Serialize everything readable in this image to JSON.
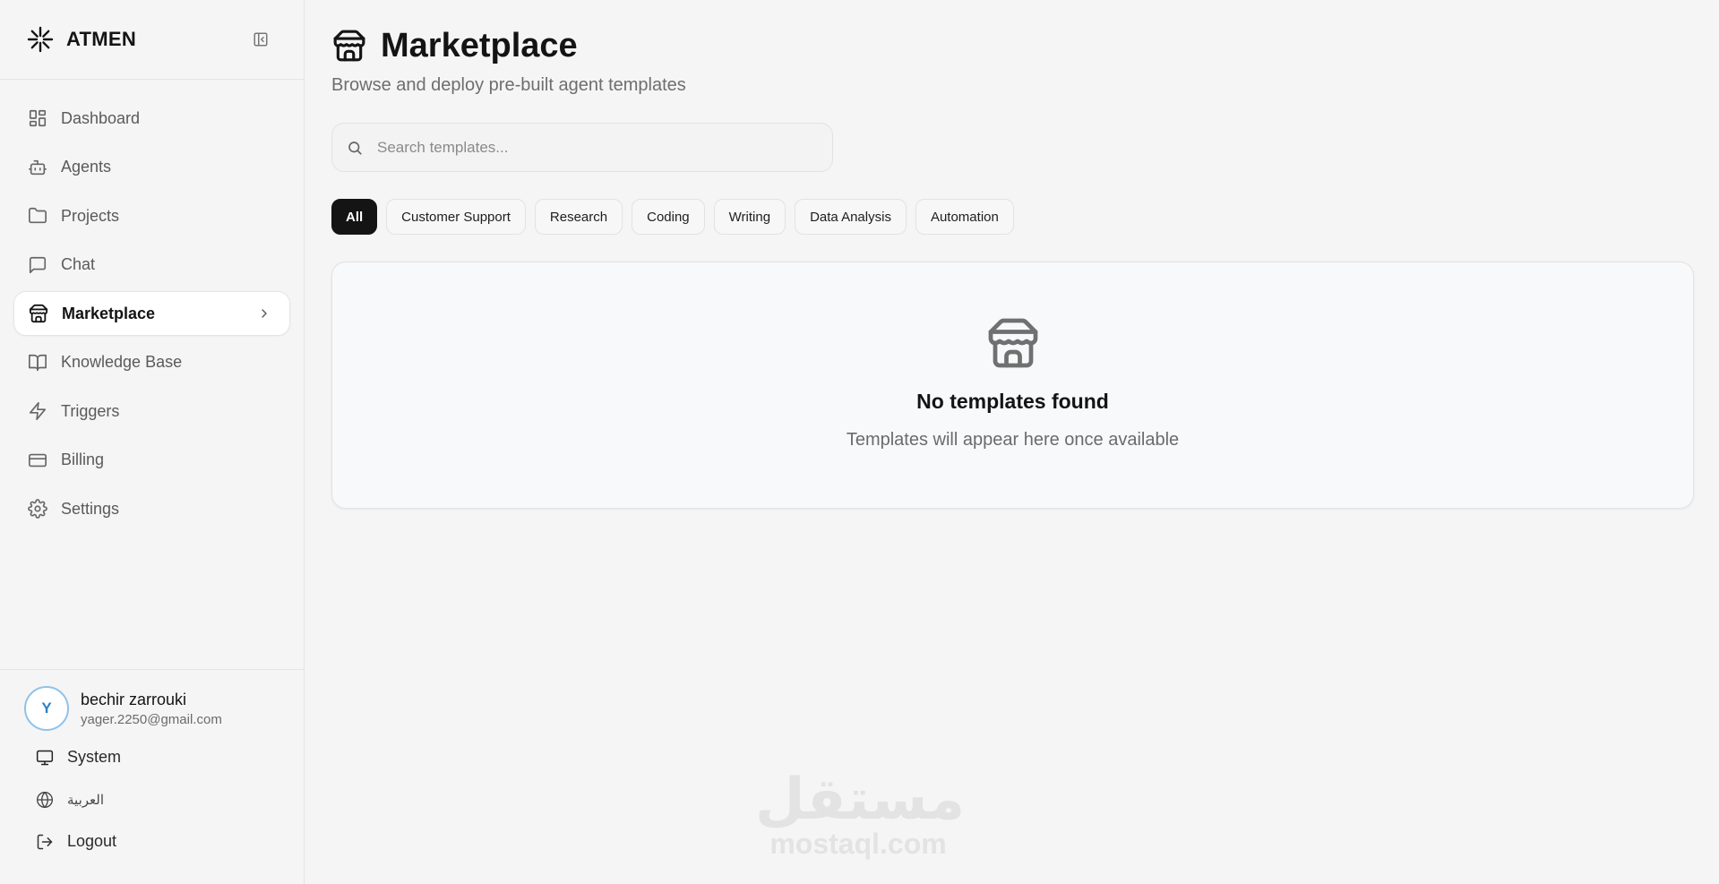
{
  "brand": {
    "name": "ATMEN"
  },
  "nav": {
    "items": [
      {
        "label": "Dashboard",
        "icon": "grid-icon"
      },
      {
        "label": "Agents",
        "icon": "bot-icon"
      },
      {
        "label": "Projects",
        "icon": "folder-icon"
      },
      {
        "label": "Chat",
        "icon": "message-icon"
      },
      {
        "label": "Marketplace",
        "icon": "store-icon",
        "active": true
      },
      {
        "label": "Knowledge Base",
        "icon": "book-icon"
      },
      {
        "label": "Triggers",
        "icon": "zap-icon"
      },
      {
        "label": "Billing",
        "icon": "credit-card-icon"
      },
      {
        "label": "Settings",
        "icon": "gear-icon"
      }
    ]
  },
  "user": {
    "initial": "Y",
    "name": "bechir zarrouki",
    "email": "yager.2250@gmail.com"
  },
  "footer": {
    "theme_label": "System",
    "language_label": "العربية",
    "logout_label": "Logout"
  },
  "page": {
    "title": "Marketplace",
    "subtitle": "Browse and deploy pre-built agent templates"
  },
  "search": {
    "placeholder": "Search templates...",
    "value": ""
  },
  "filters": [
    {
      "label": "All",
      "active": true
    },
    {
      "label": "Customer Support"
    },
    {
      "label": "Research"
    },
    {
      "label": "Coding"
    },
    {
      "label": "Writing"
    },
    {
      "label": "Data Analysis"
    },
    {
      "label": "Automation"
    }
  ],
  "empty_state": {
    "title": "No templates found",
    "subtitle": "Templates will appear here once available"
  },
  "watermark": {
    "arabic": "مستقل",
    "latin": "mostaql.com"
  },
  "colors": {
    "background": "#f5f5f5",
    "accent_dark": "#141414",
    "avatar_ring": "#8fc2ea",
    "avatar_text": "#2f7fc4"
  }
}
